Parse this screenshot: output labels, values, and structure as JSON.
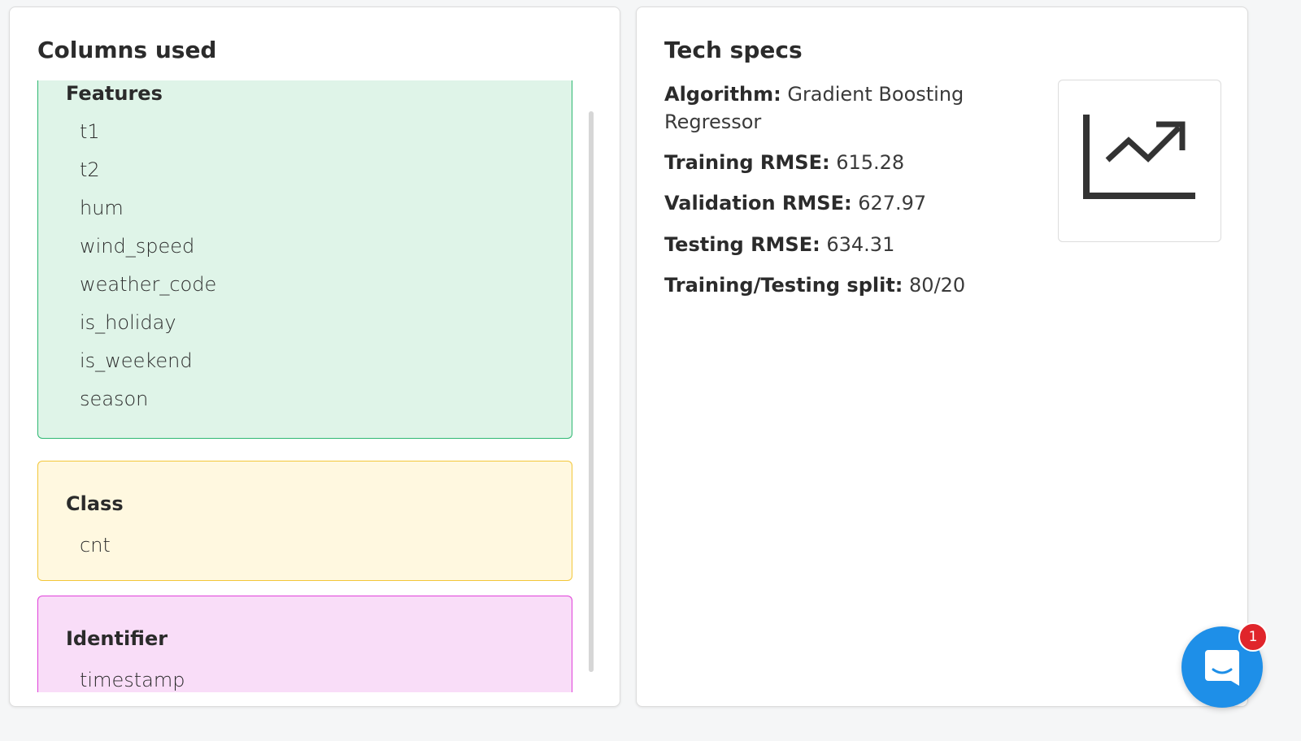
{
  "columns_panel": {
    "title": "Columns used",
    "features": {
      "title": "Features",
      "items": [
        "t1",
        "t2",
        "hum",
        "wind_speed",
        "weather_code",
        "is_holiday",
        "is_weekend",
        "season"
      ]
    },
    "class": {
      "title": "Class",
      "items": [
        "cnt"
      ]
    },
    "identifier": {
      "title": "Identifier",
      "items": [
        "timestamp"
      ]
    }
  },
  "tech_specs": {
    "title": "Tech specs",
    "algorithm_label": "Algorithm:",
    "algorithm_value": "Gradient Boosting Regressor",
    "training_rmse_label": "Training RMSE:",
    "training_rmse_value": "615.28",
    "validation_rmse_label": "Validation RMSE:",
    "validation_rmse_value": "627.97",
    "testing_rmse_label": "Testing RMSE:",
    "testing_rmse_value": "634.31",
    "split_label": "Training/Testing split:",
    "split_value": "80/20",
    "icon": "trending-up-chart-icon"
  },
  "chat": {
    "icon": "chat-bubble-icon",
    "badge_count": "1"
  },
  "colors": {
    "features_bg": "#dff4e8",
    "features_border": "#2eb872",
    "class_bg": "#fff8e0",
    "class_border": "#f3c73a",
    "identifier_bg": "#f9ddf8",
    "identifier_border": "#e041d9",
    "chat_button": "#1e8fe8",
    "badge": "#e0252b"
  }
}
